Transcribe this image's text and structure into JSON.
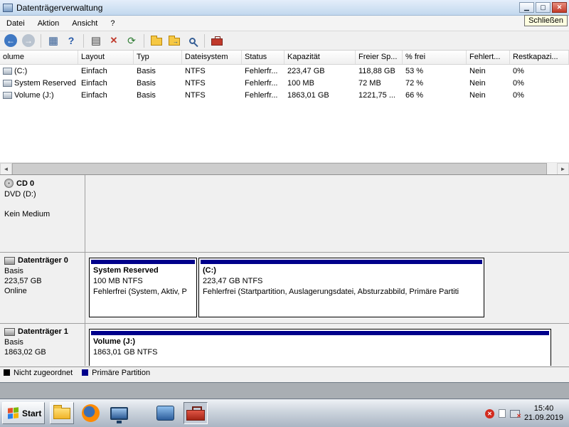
{
  "window": {
    "title": "Datenträgerverwaltung",
    "close_tooltip": "Schließen"
  },
  "menu": {
    "items": [
      "Datei",
      "Aktion",
      "Ansicht",
      "?"
    ]
  },
  "toolbar": {
    "icons": [
      "back-icon",
      "forward-icon",
      "console-tree-icon",
      "help-icon",
      "properties-icon",
      "delete-icon",
      "refresh-icon",
      "open-folder-icon",
      "export-list-icon",
      "search-icon",
      "toolbox-icon"
    ]
  },
  "volume_table": {
    "columns": [
      "olume",
      "Layout",
      "Typ",
      "Dateisystem",
      "Status",
      "Kapazität",
      "Freier Sp...",
      "% frei",
      "Fehlert...",
      "Restkapazi..."
    ],
    "rows": [
      [
        "(C:)",
        "Einfach",
        "Basis",
        "NTFS",
        "Fehlerfr...",
        "223,47 GB",
        "118,88 GB",
        "53 %",
        "Nein",
        "0%"
      ],
      [
        "System Reserved",
        "Einfach",
        "Basis",
        "NTFS",
        "Fehlerfr...",
        "100 MB",
        "72 MB",
        "72 %",
        "Nein",
        "0%"
      ],
      [
        "Volume (J:)",
        "Einfach",
        "Basis",
        "NTFS",
        "Fehlerfr...",
        "1863,01 GB",
        "1221,75 ...",
        "66 %",
        "Nein",
        "0%"
      ]
    ]
  },
  "disks": {
    "cd": {
      "name": "CD 0",
      "device": "DVD (D:)",
      "media": "Kein Medium"
    },
    "disk0": {
      "name": "Datenträger 0",
      "type": "Basis",
      "size": "223,57 GB",
      "status": "Online",
      "partitions": [
        {
          "title": "System Reserved",
          "size": "100 MB NTFS",
          "status": "Fehlerfrei (System, Aktiv, P"
        },
        {
          "title": "(C:)",
          "size": "223,47 GB NTFS",
          "status": "Fehlerfrei (Startpartition, Auslagerungsdatei, Absturzabbild, Primäre Partiti"
        }
      ]
    },
    "disk1": {
      "name": "Datenträger 1",
      "type": "Basis",
      "size": "1863,02 GB",
      "partitions": [
        {
          "title": "Volume  (J:)",
          "size": "1863,01 GB NTFS"
        }
      ]
    }
  },
  "legend": {
    "items": [
      {
        "label": "Nicht zugeordnet",
        "color": "#000000"
      },
      {
        "label": "Primäre Partition",
        "color": "#00008b"
      }
    ]
  },
  "colors": {
    "partition_stripe": "#00008b"
  },
  "taskbar": {
    "start_label": "Start",
    "clock_time": "15:40",
    "clock_date": "21.09.2019"
  }
}
